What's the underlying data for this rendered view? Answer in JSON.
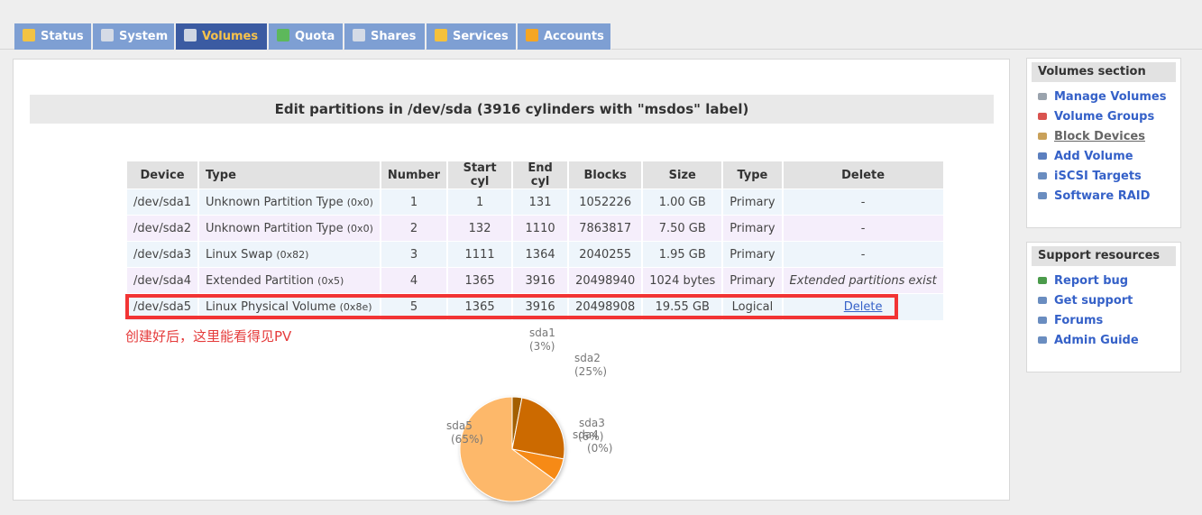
{
  "tabs": [
    {
      "label": "Status",
      "icon": "weather-icon",
      "color": "#f3c343"
    },
    {
      "label": "System",
      "icon": "monitor-icon",
      "color": "#d5dbe6"
    },
    {
      "label": "Volumes",
      "icon": "drive-icon",
      "color": "#cfd6e3",
      "active": true
    },
    {
      "label": "Quota",
      "icon": "pie-icon",
      "color": "#5db85b"
    },
    {
      "label": "Shares",
      "icon": "stack-icon",
      "color": "#d5dbe6"
    },
    {
      "label": "Services",
      "icon": "lightning-icon",
      "color": "#f5c13b"
    },
    {
      "label": "Accounts",
      "icon": "users-icon",
      "color": "#f5a623"
    }
  ],
  "main": {
    "title": "Edit partitions in /dev/sda (3916 cylinders with \"msdos\" label)",
    "columns": [
      "Device",
      "Type",
      "Number",
      "Start cyl",
      "End cyl",
      "Blocks",
      "Size",
      "Type",
      "Delete"
    ],
    "rows": [
      {
        "device": "/dev/sda1",
        "type": "Unknown Partition Type",
        "code": "(0x0)",
        "number": "1",
        "start": "1",
        "end": "131",
        "blocks": "1052226",
        "size": "1.00 GB",
        "ptype": "Primary",
        "delete": "-"
      },
      {
        "device": "/dev/sda2",
        "type": "Unknown Partition Type",
        "code": "(0x0)",
        "number": "2",
        "start": "132",
        "end": "1110",
        "blocks": "7863817",
        "size": "7.50 GB",
        "ptype": "Primary",
        "delete": "-"
      },
      {
        "device": "/dev/sda3",
        "type": "Linux Swap",
        "code": "(0x82)",
        "number": "3",
        "start": "1111",
        "end": "1364",
        "blocks": "2040255",
        "size": "1.95 GB",
        "ptype": "Primary",
        "delete": "-"
      },
      {
        "device": "/dev/sda4",
        "type": "Extended Partition",
        "code": "(0x5)",
        "number": "4",
        "start": "1365",
        "end": "3916",
        "blocks": "20498940",
        "size": "1024 bytes",
        "ptype": "Primary",
        "delete": "Extended partitions exist"
      },
      {
        "device": "/dev/sda5",
        "type": "Linux Physical Volume",
        "code": "(0x8e)",
        "number": "5",
        "start": "1365",
        "end": "3916",
        "blocks": "20498908",
        "size": "19.55 GB",
        "ptype": "Logical",
        "delete": "Delete"
      }
    ],
    "annotation": "创建好后，这里能看得见PV"
  },
  "chart_data": {
    "type": "pie",
    "slices": [
      {
        "name": "sda1",
        "value": 3,
        "label": "(3%)",
        "color": "#a35f00"
      },
      {
        "name": "sda2",
        "value": 25,
        "label": "(25%)",
        "color": "#cc6a00"
      },
      {
        "name": "sda3",
        "value": 7,
        "label": "(6%)",
        "color": "#f68a12"
      },
      {
        "name": "sda4",
        "value": 0,
        "label": "(0%)",
        "color": "#f8a33a"
      },
      {
        "name": "sda5",
        "value": 65,
        "label": "(65%)",
        "color": "#fdb86a"
      }
    ]
  },
  "sidebar": {
    "volumes": {
      "title": "Volumes section",
      "items": [
        {
          "label": "Manage Volumes",
          "icon": "drive-icon",
          "color": "#9aa3ad"
        },
        {
          "label": "Volume Groups",
          "icon": "group-icon",
          "color": "#d9534f"
        },
        {
          "label": "Block Devices",
          "icon": "block-icon",
          "color": "#c9a15a",
          "current": true
        },
        {
          "label": "Add Volume",
          "icon": "add-drive-icon",
          "color": "#5b7fbf"
        },
        {
          "label": "iSCSI Targets",
          "icon": "target-icon",
          "color": "#6a8dc0"
        },
        {
          "label": "Software RAID",
          "icon": "raid-icon",
          "color": "#6a8dc0"
        }
      ]
    },
    "support": {
      "title": "Support resources",
      "items": [
        {
          "label": "Report bug",
          "icon": "bug-icon",
          "color": "#4b9b4b"
        },
        {
          "label": "Get support",
          "icon": "support-icon",
          "color": "#6a8dc0"
        },
        {
          "label": "Forums",
          "icon": "forum-icon",
          "color": "#6a8dc0"
        },
        {
          "label": "Admin Guide",
          "icon": "book-icon",
          "color": "#6a8dc0"
        }
      ]
    }
  }
}
